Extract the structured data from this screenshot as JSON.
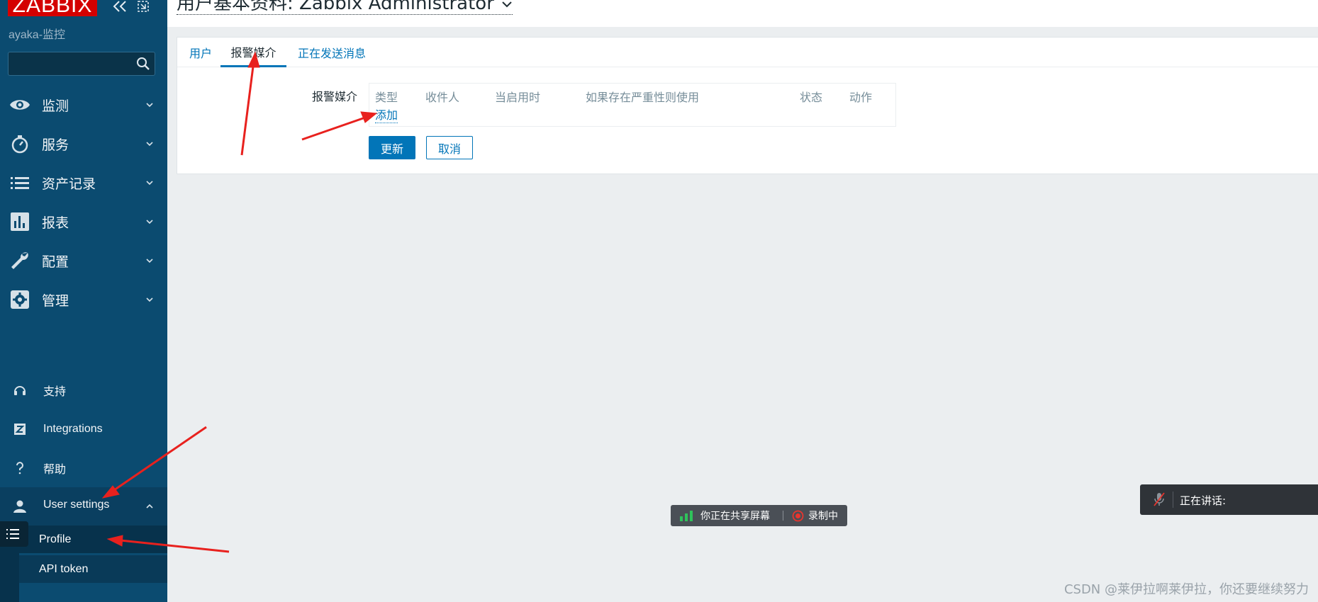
{
  "sidebar": {
    "logo": "ZABBIX",
    "server_name": "ayaka-监控",
    "search_value": "",
    "menu": [
      {
        "label": "监测",
        "icon": "eye-icon"
      },
      {
        "label": "服务",
        "icon": "stopwatch-icon"
      },
      {
        "label": "资产记录",
        "icon": "list-icon"
      },
      {
        "label": "报表",
        "icon": "bar-chart-icon"
      },
      {
        "label": "配置",
        "icon": "wrench-icon"
      },
      {
        "label": "管理",
        "icon": "gear-icon"
      }
    ],
    "bottom": [
      {
        "label": "支持",
        "icon": "headset-icon"
      },
      {
        "label": "Integrations",
        "icon": "zabbix-z-icon"
      },
      {
        "label": "帮助",
        "icon": "question-icon"
      }
    ],
    "user_settings": {
      "label": "User settings",
      "icon": "user-icon",
      "submenu": [
        "Profile",
        "API token"
      ]
    }
  },
  "header": {
    "title": "用户基本资料: Zabbix Administrator"
  },
  "tabs": [
    {
      "label": "用户",
      "active": false
    },
    {
      "label": "报警媒介",
      "active": true
    },
    {
      "label": "正在发送消息",
      "active": false
    }
  ],
  "form": {
    "media_label": "报警媒介",
    "columns": [
      "类型",
      "收件人",
      "当启用时",
      "如果存在严重性则使用",
      "状态",
      "动作"
    ],
    "add_link": "添加",
    "update_button": "更新",
    "cancel_button": "取消"
  },
  "overlays": {
    "sharing_text": "你正在共享屏幕",
    "recording_text": "录制中",
    "speaking_text": "正在讲话:"
  },
  "watermark": "CSDN @莱伊拉啊莱伊拉，你还要继续努力",
  "colors": {
    "sidebar_bg": "#0b4b70",
    "logo_red": "#d40000",
    "accent_blue": "#0275b8",
    "annotation_red": "#e8211e"
  }
}
